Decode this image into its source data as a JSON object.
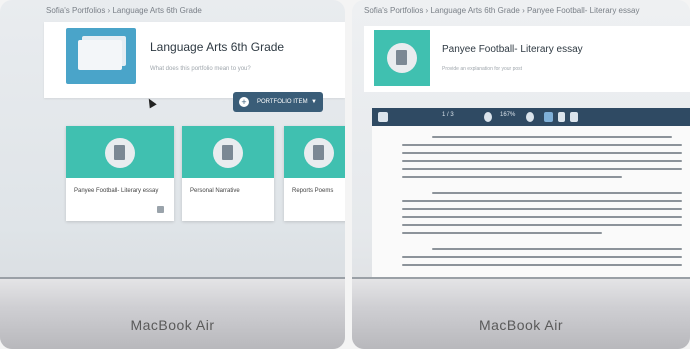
{
  "left_photo": {
    "breadcrumb": "Sofia's Portfolios  ›  Language Arts 6th Grade",
    "portfolio": {
      "title": "Language Arts 6th Grade",
      "description_placeholder": "What does this portfolio mean to you?"
    },
    "create_button": {
      "label": "PORTFOLIO ITEM",
      "icon": "plus-icon"
    },
    "cards": [
      {
        "name": "Panyee Football- Literary essay"
      },
      {
        "name": "Personal Narrative"
      },
      {
        "name": "Reports Poems"
      }
    ],
    "laptop_label": "MacBook Air"
  },
  "right_photo": {
    "breadcrumb": "Sofia's Portfolios  ›  Language Arts 6th Grade  ›  Panyee Football- Literary essay",
    "item": {
      "title": "Panyee Football- Literary essay",
      "description_placeholder": "Provide an explanation for your post"
    },
    "toolbar": {
      "page": "1 / 3",
      "zoom": "167%"
    },
    "laptop_label": "MacBook Air"
  },
  "colors": {
    "teal": "#40c0b0",
    "navy": "#2f4a63",
    "blue": "#4aa4c9"
  }
}
